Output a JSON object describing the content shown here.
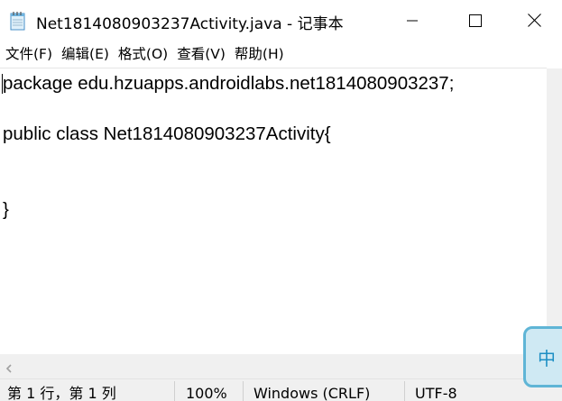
{
  "window": {
    "title": "Net1814080903237Activity.java - 记事本",
    "icon": "notepad-icon",
    "controls": [
      "minimize-icon",
      "maximize-icon",
      "close-icon"
    ]
  },
  "menu": {
    "items": [
      {
        "label": "文件(F)"
      },
      {
        "label": "编辑(E)"
      },
      {
        "label": "格式(O)"
      },
      {
        "label": "查看(V)"
      },
      {
        "label": "帮助(H)"
      }
    ]
  },
  "editor": {
    "lines": [
      "package edu.hzuapps.androidlabs.net1814080903237;",
      "",
      "public class Net1814080903237Activity{",
      "",
      "",
      "}"
    ]
  },
  "status": {
    "position": "第 1 行，第 1 列",
    "zoom": "100%",
    "line_ending": "Windows (CRLF)",
    "encoding": "UTF-8"
  },
  "ime": {
    "mode_char": "中",
    "icon": "ime-indicator-icon"
  },
  "colors": {
    "accent": "#1d8fc4",
    "statusbar_bg": "#f0f0f0"
  }
}
